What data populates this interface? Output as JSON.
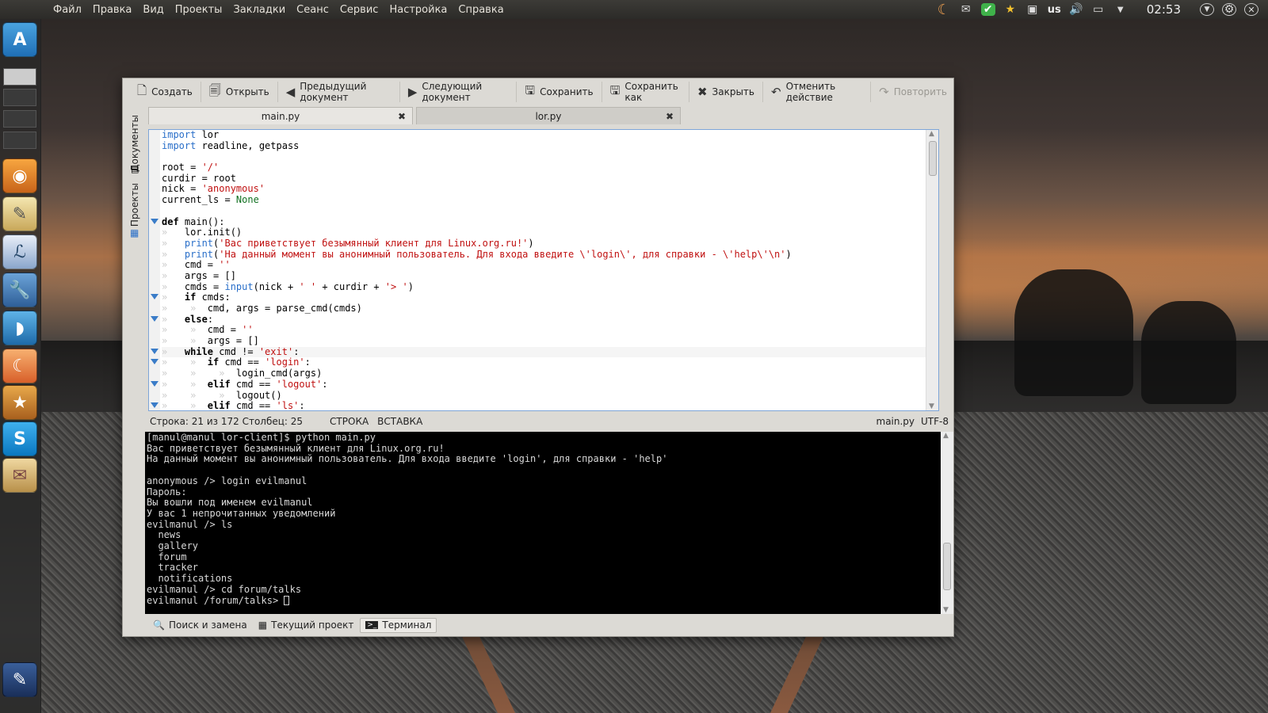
{
  "top_menu": [
    "Файл",
    "Правка",
    "Вид",
    "Проекты",
    "Закладки",
    "Сеанс",
    "Сервис",
    "Настройка",
    "Справка"
  ],
  "tray": {
    "keyboard_layout": "us",
    "clock": "02:53"
  },
  "toolbar": {
    "new_label": "Создать",
    "open_label": "Открыть",
    "prev_label": "Предыдущий документ",
    "next_label": "Следующий документ",
    "save_label": "Сохранить",
    "save_as_label": "Сохранить как",
    "close_label": "Закрыть",
    "undo_label": "Отменить действие",
    "redo_label": "Повторить"
  },
  "side_tabs": {
    "documents": "Документы",
    "projects": "Проекты"
  },
  "tabs": [
    {
      "label": "main.py",
      "active": true
    },
    {
      "label": "lor.py",
      "active": false
    }
  ],
  "code_lines": [
    [
      [
        "kw0",
        "import"
      ],
      [
        "p",
        " lor"
      ]
    ],
    [
      [
        "kw0",
        "import"
      ],
      [
        "p",
        " readline, getpass"
      ]
    ],
    [],
    [
      [
        "p",
        "root = "
      ],
      [
        "st",
        "'/'"
      ]
    ],
    [
      [
        "p",
        "curdir = root"
      ]
    ],
    [
      [
        "p",
        "nick = "
      ],
      [
        "st",
        "'anonymous'"
      ]
    ],
    [
      [
        "p",
        "current_ls = "
      ],
      [
        "nn",
        "None"
      ]
    ],
    [],
    [
      [
        "kw",
        "def"
      ],
      [
        "p",
        " main():"
      ]
    ],
    [
      [
        "t",
        "» "
      ],
      [
        "p",
        "  lor.init()"
      ]
    ],
    [
      [
        "t",
        "» "
      ],
      [
        "bi",
        "  print"
      ],
      [
        "p",
        "("
      ],
      [
        "st",
        "'Вас приветствует безымянный клиент для Linux.org.ru!'"
      ],
      [
        "p",
        ")"
      ]
    ],
    [
      [
        "t",
        "» "
      ],
      [
        "bi",
        "  print"
      ],
      [
        "p",
        "("
      ],
      [
        "st",
        "'На данный момент вы анонимный пользователь. Для входа введите \\'login\\', для справки - \\'help\\'\\n'"
      ],
      [
        "p",
        ")"
      ]
    ],
    [
      [
        "t",
        "» "
      ],
      [
        "p",
        "  cmd = "
      ],
      [
        "st",
        "''"
      ]
    ],
    [
      [
        "t",
        "» "
      ],
      [
        "p",
        "  args = []"
      ]
    ],
    [
      [
        "t",
        "» "
      ],
      [
        "p",
        "  cmds = "
      ],
      [
        "bi",
        "input"
      ],
      [
        "p",
        "(nick + "
      ],
      [
        "st",
        "' '"
      ],
      [
        "p",
        " + curdir + "
      ],
      [
        "st",
        "'> '"
      ],
      [
        "p",
        ")"
      ]
    ],
    [
      [
        "t",
        "» "
      ],
      [
        "kw",
        "  if"
      ],
      [
        "p",
        " cmds:"
      ]
    ],
    [
      [
        "t",
        "» "
      ],
      [
        "t",
        "   » "
      ],
      [
        "p",
        " cmd, args = parse_cmd(cmds)"
      ]
    ],
    [
      [
        "t",
        "» "
      ],
      [
        "kw",
        "  else"
      ],
      [
        "p",
        ":"
      ]
    ],
    [
      [
        "t",
        "» "
      ],
      [
        "t",
        "   » "
      ],
      [
        "p",
        " cmd = "
      ],
      [
        "st",
        "''"
      ]
    ],
    [
      [
        "t",
        "» "
      ],
      [
        "t",
        "   » "
      ],
      [
        "p",
        " args = []"
      ]
    ],
    [
      [
        "t",
        "» "
      ],
      [
        "kw",
        "  while"
      ],
      [
        "p",
        " cmd != "
      ],
      [
        "st",
        "'exit'"
      ],
      [
        "p",
        ":"
      ]
    ],
    [
      [
        "t",
        "» "
      ],
      [
        "t",
        "   » "
      ],
      [
        "kw",
        " if"
      ],
      [
        "p",
        " cmd == "
      ],
      [
        "st",
        "'login'"
      ],
      [
        "p",
        ":"
      ]
    ],
    [
      [
        "t",
        "» "
      ],
      [
        "t",
        "   » "
      ],
      [
        "t",
        "   » "
      ],
      [
        "p",
        " login_cmd(args)"
      ]
    ],
    [
      [
        "t",
        "» "
      ],
      [
        "t",
        "   » "
      ],
      [
        "kw",
        " elif"
      ],
      [
        "p",
        " cmd == "
      ],
      [
        "st",
        "'logout'"
      ],
      [
        "p",
        ":"
      ]
    ],
    [
      [
        "t",
        "» "
      ],
      [
        "t",
        "   » "
      ],
      [
        "t",
        "   » "
      ],
      [
        "p",
        " logout()"
      ]
    ],
    [
      [
        "t",
        "» "
      ],
      [
        "t",
        "   » "
      ],
      [
        "kw",
        " elif"
      ],
      [
        "p",
        " cmd == "
      ],
      [
        "st",
        "'ls'"
      ],
      [
        "p",
        ":"
      ]
    ]
  ],
  "status": {
    "position": "Строка: 21 из 172 Столбец: 25",
    "mode1": "СТРОКА",
    "mode2": "ВСТАВКА",
    "file": "main.py",
    "encoding": "UTF-8"
  },
  "terminal": [
    "[manul@manul lor-client]$ python main.py",
    "Вас приветствует безымянный клиент для Linux.org.ru!",
    "На данный момент вы анонимный пользователь. Для входа введите 'login', для справки - 'help'",
    "",
    "anonymous /> login evilmanul",
    "Пароль:",
    "Вы вошли под именем evilmanul",
    "У вас 1 непрочитанных уведомлений",
    "evilmanul /> ls",
    "  news",
    "  gallery",
    "  forum",
    "  tracker",
    "  notifications",
    "evilmanul /> cd forum/talks",
    "evilmanul /forum/talks> "
  ],
  "bottom_tabs": {
    "search": "Поиск и замена",
    "project": "Текущий проект",
    "terminal": "Терминал"
  }
}
